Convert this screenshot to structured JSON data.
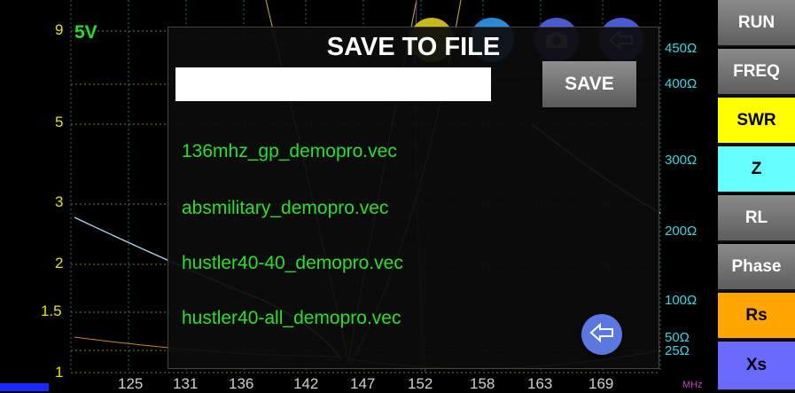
{
  "chart": {
    "voltage_label": "5V",
    "y_ticks": [
      "9",
      "5",
      "3",
      "2",
      "1.5",
      "1"
    ],
    "impedance_ticks": [
      "450Ω",
      "400Ω",
      "300Ω",
      "200Ω",
      "100Ω",
      "50Ω",
      "25Ω"
    ],
    "x_ticks": [
      "125",
      "131",
      "136",
      "142",
      "147",
      "152",
      "158",
      "163",
      "169"
    ],
    "x_unit": "MHz"
  },
  "sidebar": {
    "items": [
      {
        "label": "RUN",
        "color": "#6e6e6e"
      },
      {
        "label": "FREQ",
        "color": "#6e6e6e"
      },
      {
        "label": "SWR",
        "color": "#ffff00"
      },
      {
        "label": "Z",
        "color": "#66ffff"
      },
      {
        "label": "RL",
        "color": "#6e6e6e"
      },
      {
        "label": "Phase",
        "color": "#6e6e6e"
      },
      {
        "label": "Rs",
        "color": "#ffa500"
      },
      {
        "label": "Xs",
        "color": "#6a6aff"
      }
    ]
  },
  "dialog": {
    "title": "SAVE TO FILE",
    "filename_value": "",
    "save_label": "SAVE",
    "files": [
      "136mhz_gp_demopro.vec",
      "absmilitary_demopro.vec",
      "hustler40-40_demopro.vec",
      "hustler40-all_demopro.vec"
    ]
  },
  "colors": {
    "swr_axis": "#e8e000",
    "impedance_axis": "#33d6e6",
    "file_text": "#28e028"
  }
}
